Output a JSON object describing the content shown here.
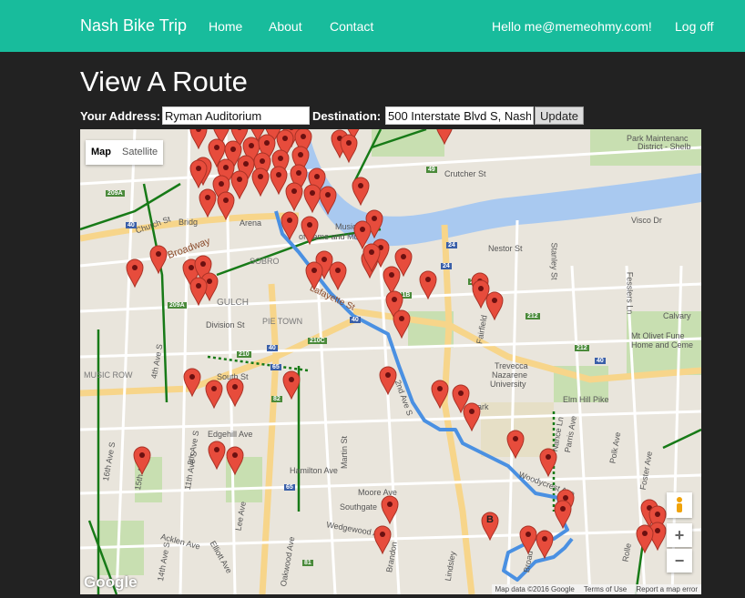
{
  "navbar": {
    "brand": "Nash Bike Trip",
    "links": [
      "Home",
      "About",
      "Contact"
    ],
    "greeting": "Hello me@memeohmy.com!",
    "logoff": "Log off",
    "color": "#18bc9c"
  },
  "page": {
    "title": "View A Route"
  },
  "form": {
    "address_label": "Your Address:",
    "address_value": "Ryman Auditorium",
    "destination_label": "Destination:",
    "destination_value": "500 Interstate Blvd S, Nashville",
    "update_label": "Update"
  },
  "map": {
    "type_buttons": [
      "Map",
      "Satellite"
    ],
    "selected_type": "Map",
    "marker_b_label": "B",
    "zoom_in": "+",
    "zoom_out": "−",
    "logo": "Google",
    "attribution": [
      "Map data ©2016 Google",
      "Terms of Use",
      "Report a map error"
    ],
    "colors": {
      "marker": "#e74c3c",
      "route": "#4a90e2",
      "river": "#a9c9f0",
      "bike_lane": "#177a17",
      "park": "#c8dfb1"
    },
    "labels": [
      "Crutcher St",
      "Visco Dr",
      "Nestor St",
      "Stanley St",
      "Music Hall",
      "of Fame and Mus",
      "Arena",
      "Bridg",
      "Broadway",
      "Church St",
      "SOBRO",
      "GULCH",
      "PIE TOWN",
      "Division St",
      "Lafayette St",
      "MUSIC ROW",
      "South St",
      "Fairfield",
      "Trevecca",
      "Nazarene",
      "University",
      "Elm Hill Pike",
      "Calvary",
      "Mt Olivet Fune",
      "Home and Ceme",
      "Fesslers Ln",
      "Nance Ln",
      "Parris Ave",
      "Polk Ave",
      "Foster Ave",
      "Woodycrest Ave",
      "Moore Ave",
      "Southgate",
      "Wedgewood Ave",
      "Hamilton Ave",
      "Edgehill Ave",
      "Acklen Ave",
      "Elliott Ave",
      "Martin St",
      "2nd Ave S",
      "4th Ave S",
      "8th Ave S",
      "11th Ave S",
      "15th Ave S",
      "16th Ave S",
      "14th Ave S",
      "Brandon",
      "Lindsley",
      "Park Maintenanc",
      "District - Shelb",
      "Rolle",
      "Oakwood Ave",
      "Lee Ave",
      "Broad",
      "Park"
    ],
    "shields": [
      "209A",
      "209A",
      "40",
      "24",
      "24",
      "211",
      "211B",
      "212",
      "212",
      "210",
      "210C",
      "40",
      "40",
      "65",
      "65",
      "81",
      "82",
      "49",
      "40"
    ]
  }
}
